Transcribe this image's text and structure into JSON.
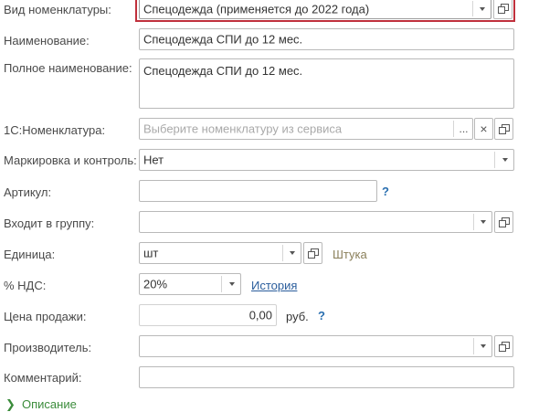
{
  "form": {
    "kind": {
      "label": "Вид номенклатуры:",
      "value": "Спецодежда (применяется до 2022 года)"
    },
    "name": {
      "label": "Наименование:",
      "value": "Спецодежда СПИ до 12 мес."
    },
    "full_name": {
      "label": "Полное наименование:",
      "value": "Спецодежда СПИ до 12 мес."
    },
    "nomenclature_1c": {
      "label": "1С:Номенклатура:",
      "placeholder": "Выберите номенклатуру из сервиса",
      "more_label": "...",
      "clear_label": "×"
    },
    "marking": {
      "label": "Маркировка и контроль:",
      "value": "Нет"
    },
    "article": {
      "label": "Артикул:",
      "value": "",
      "help": "?"
    },
    "group": {
      "label": "Входит в группу:",
      "value": ""
    },
    "unit": {
      "label": "Единица:",
      "value": "шт",
      "hint": "Штука"
    },
    "vat": {
      "label": "% НДС:",
      "value": "20%",
      "history_link": "История"
    },
    "price": {
      "label": "Цена продажи:",
      "value": "0,00",
      "currency": "руб.",
      "help": "?"
    },
    "manufacturer": {
      "label": "Производитель:",
      "value": ""
    },
    "comment": {
      "label": "Комментарий:",
      "value": ""
    },
    "description_section": {
      "label": "Описание"
    }
  },
  "colors": {
    "active_border": "#c0303c",
    "link": "#2a5d9c",
    "help": "#2a6fb0",
    "hint": "#8a7f5a",
    "section": "#3b8c3b"
  },
  "icons": {
    "dropdown": "chevron-down-icon",
    "open": "open-form-icon",
    "help": "help-icon",
    "section": "chevron-right-icon"
  }
}
